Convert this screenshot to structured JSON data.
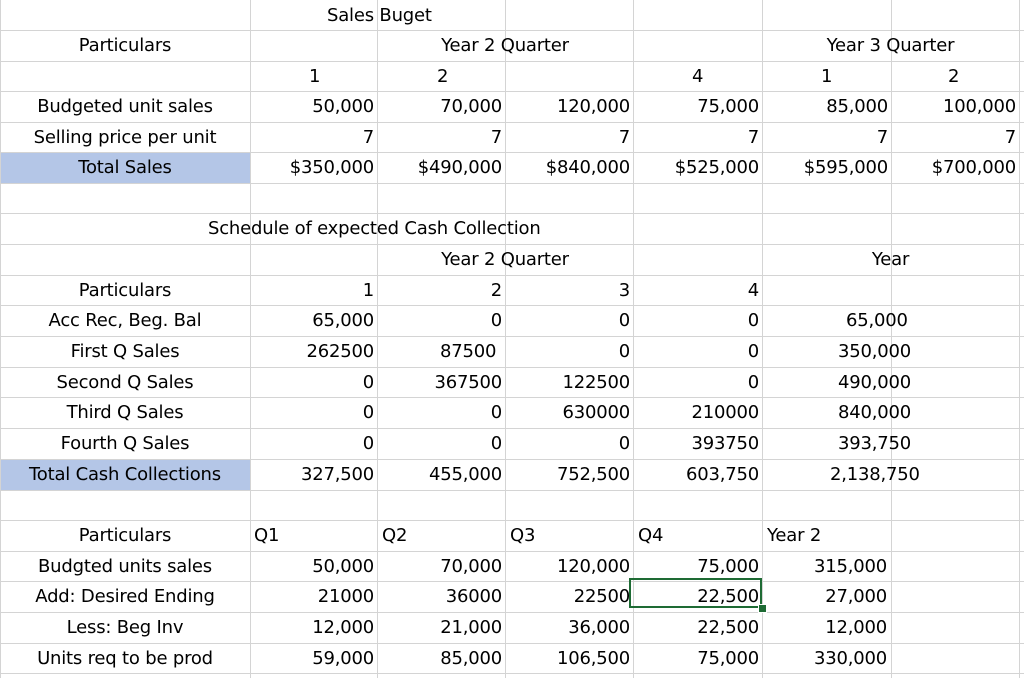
{
  "sales_budget": {
    "title": "Sales Buget",
    "particulars_header": "Particulars",
    "year2_header": "Year 2 Quarter",
    "year3_header": "Year 3 Quarter",
    "quarters": [
      "1",
      "2",
      "",
      "4",
      "1",
      "2"
    ],
    "rows": [
      {
        "label": "Budgeted unit sales",
        "values": [
          "50,000",
          "70,000",
          "120,000",
          "75,000",
          "85,000",
          "100,000"
        ]
      },
      {
        "label": "Selling price per unit",
        "values": [
          "7",
          "7",
          "7",
          "7",
          "7",
          "7"
        ]
      },
      {
        "label": "Total Sales",
        "values": [
          "$350,000",
          "$490,000",
          "$840,000",
          "$525,000",
          "$595,000",
          "$700,000"
        ]
      }
    ]
  },
  "cash_collection": {
    "title": "Schedule of expected Cash Collection",
    "year2_header": "Year 2 Quarter",
    "year_header": "Year",
    "particulars_header": "Particulars",
    "quarters": [
      "1",
      "2",
      "3",
      "4"
    ],
    "rows": [
      {
        "label": "Acc Rec, Beg. Bal",
        "values": [
          "65,000",
          "0",
          "0",
          "0"
        ],
        "year": "65,000"
      },
      {
        "label": "First Q Sales",
        "values": [
          "262500",
          "87500",
          "0",
          "0"
        ],
        "year": "350,000"
      },
      {
        "label": "Second Q Sales",
        "values": [
          "0",
          "367500",
          "122500",
          "0"
        ],
        "year": "490,000"
      },
      {
        "label": "Third Q Sales",
        "values": [
          "0",
          "0",
          "630000",
          "210000"
        ],
        "year": "840,000"
      },
      {
        "label": "Fourth Q Sales",
        "values": [
          "0",
          "0",
          "0",
          "393750"
        ],
        "year": "393,750"
      },
      {
        "label": "Total Cash Collections",
        "values": [
          "327,500",
          "455,000",
          "752,500",
          "603,750"
        ],
        "year": "2,138,750"
      }
    ]
  },
  "production": {
    "particulars_header": "Particulars",
    "col_headers": [
      "Q1",
      "Q2",
      "Q3",
      "Q4",
      "Year 2"
    ],
    "rows": [
      {
        "label": "Budgted units sales",
        "values": [
          "50,000",
          "70,000",
          "120,000",
          "75,000",
          "315,000"
        ]
      },
      {
        "label": "Add: Desired Ending",
        "values": [
          "21000",
          "36000",
          "22500",
          "22,500",
          "27,000"
        ]
      },
      {
        "label": "Less: Beg Inv",
        "values": [
          "12,000",
          "21,000",
          "36,000",
          "22,500",
          "12,000"
        ]
      },
      {
        "label": "Units req to be prod",
        "values": [
          "59,000",
          "85,000",
          "106,500",
          "75,000",
          "330,000"
        ]
      }
    ]
  },
  "colors": {
    "highlight": "#b4c6e7",
    "gridline": "#d4d4d4",
    "selection": "#1e6b34"
  }
}
